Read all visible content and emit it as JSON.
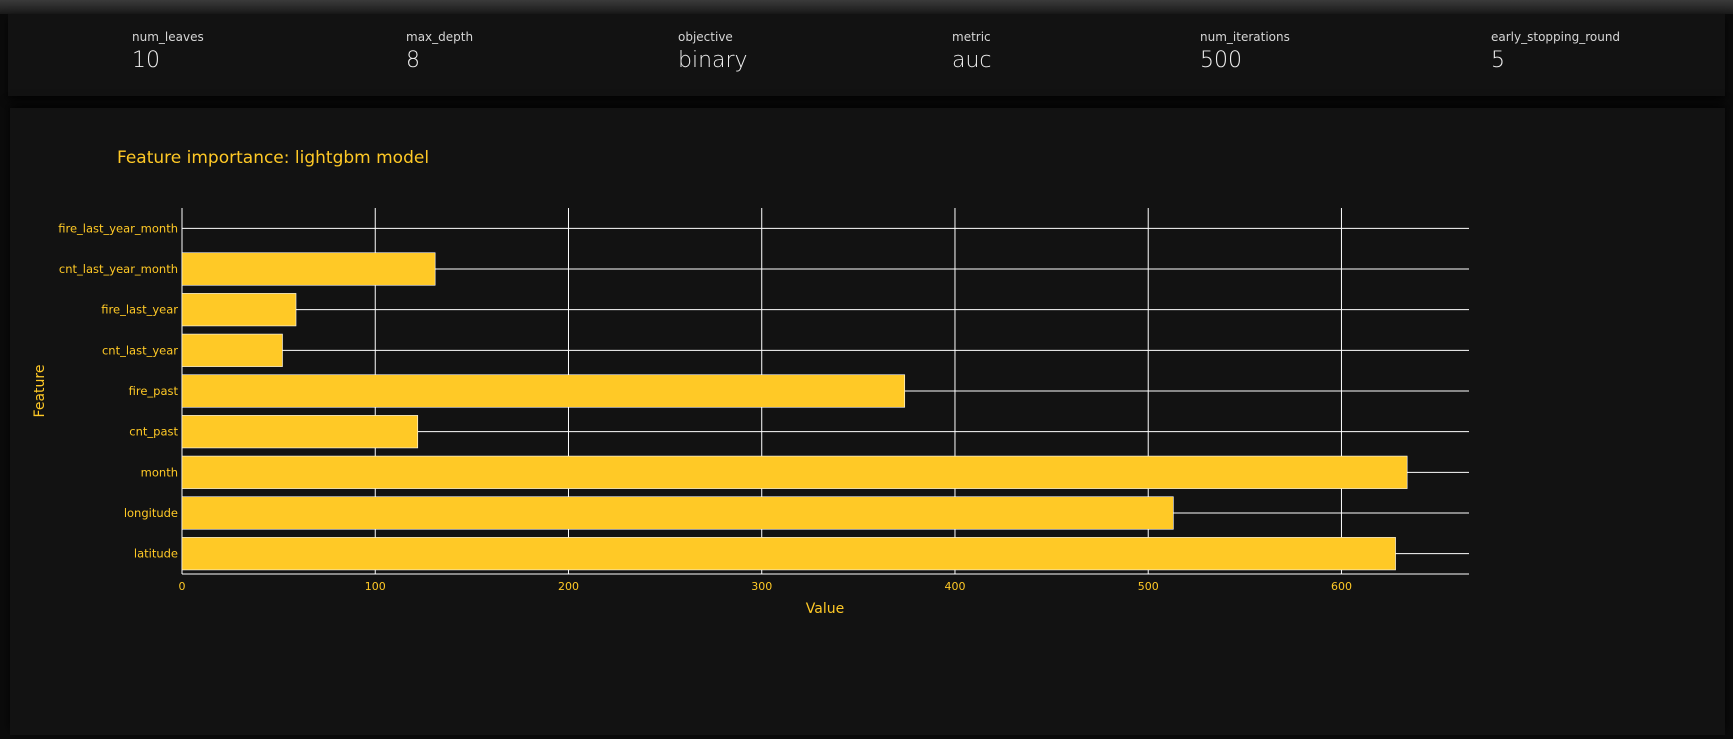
{
  "params": [
    {
      "name": "num_leaves",
      "value": "10"
    },
    {
      "name": "max_depth",
      "value": "8"
    },
    {
      "name": "objective",
      "value": "binary"
    },
    {
      "name": "metric",
      "value": "auc"
    },
    {
      "name": "num_iterations",
      "value": "500"
    },
    {
      "name": "early_stopping_round",
      "value": "5"
    }
  ],
  "chart_data": {
    "type": "bar",
    "orientation": "horizontal",
    "title": "Feature importance: lightgbm model",
    "xlabel": "Value",
    "ylabel": "Feature",
    "categories": [
      "fire_last_year_month",
      "cnt_last_year_month",
      "fire_last_year",
      "cnt_last_year",
      "fire_past",
      "cnt_past",
      "month",
      "longitude",
      "latitude"
    ],
    "values": [
      0,
      131,
      59,
      52,
      374,
      122,
      634,
      513,
      628
    ],
    "xlim": [
      0,
      666
    ],
    "xticks": [
      0,
      100,
      200,
      300,
      400,
      500,
      600
    ],
    "grid": true,
    "colors": {
      "bar": "#ffc926",
      "text": "#ffc926",
      "grid": "#ffffff",
      "background": "#121212"
    }
  }
}
